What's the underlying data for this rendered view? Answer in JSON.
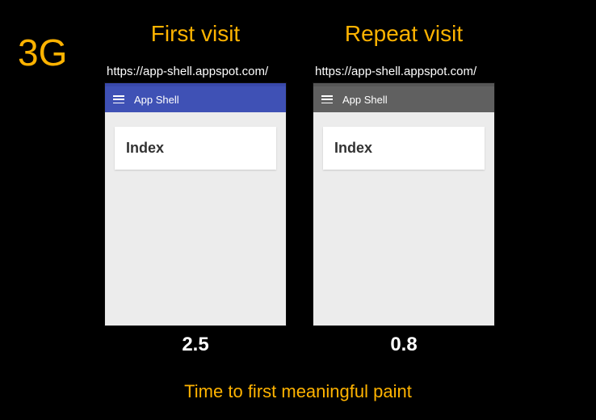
{
  "network_badge": "3G",
  "columns": [
    {
      "title": "First visit",
      "url": "https://app-shell.appspot.com/",
      "app_title": "App Shell",
      "card_heading": "Index",
      "timing": "2.5",
      "appbar_variant": "blue"
    },
    {
      "title": "Repeat visit",
      "url": "https://app-shell.appspot.com/",
      "app_title": "App Shell",
      "card_heading": "Index",
      "timing": "0.8",
      "appbar_variant": "grey"
    }
  ],
  "caption": "Time to first meaningful paint",
  "colors": {
    "accent": "#ffb300",
    "appbar_blue": "#3f51b5",
    "appbar_grey": "#606060",
    "bg": "#000000"
  }
}
